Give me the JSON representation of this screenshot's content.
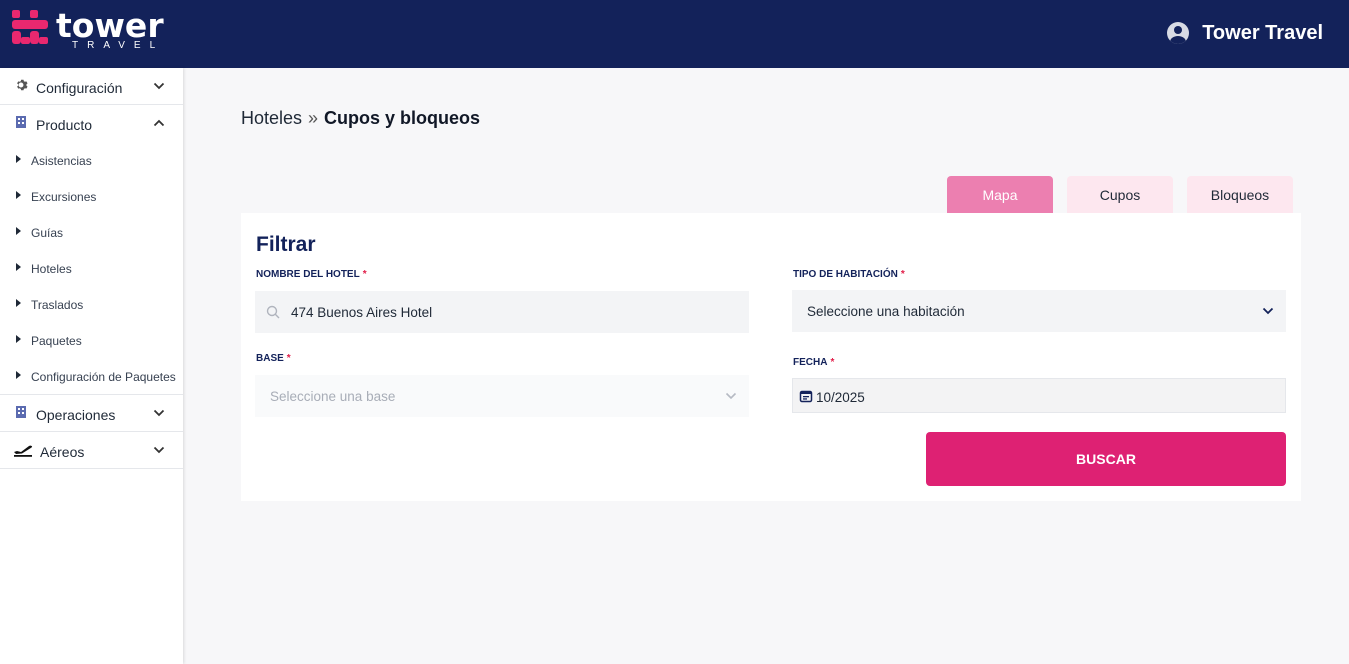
{
  "header": {
    "logo_word": "tower",
    "logo_sub": "TRAVEL",
    "user_name": "Tower Travel",
    "colors": {
      "bar": "#13225a",
      "brand_pink": "#e8286f"
    }
  },
  "sidebar": {
    "groups": [
      {
        "label": "Configuración",
        "icon": "gear-icon",
        "expanded": false
      },
      {
        "label": "Producto",
        "icon": "building-icon",
        "expanded": true,
        "items": [
          "Asistencias",
          "Excursiones",
          "Guías",
          "Hoteles",
          "Traslados",
          "Paquetes",
          "Configuración de Paquetes"
        ]
      },
      {
        "label": "Operaciones",
        "icon": "building-icon",
        "expanded": false
      },
      {
        "label": "Aéreos",
        "icon": "airplane-icon",
        "expanded": false
      }
    ]
  },
  "breadcrumb": {
    "parent": "Hoteles",
    "separator": "»",
    "current": "Cupos y bloqueos"
  },
  "tabs": [
    {
      "label": "Mapa",
      "active": true
    },
    {
      "label": "Cupos",
      "active": false
    },
    {
      "label": "Bloqueos",
      "active": false
    }
  ],
  "filter": {
    "title": "Filtrar",
    "hotel_label": "NOMBRE DEL HOTEL",
    "hotel_value": "474 Buenos Aires Hotel",
    "room_label": "TIPO DE HABITACIÓN",
    "room_value": "Seleccione una habitación",
    "base_label": "BASE",
    "base_placeholder": "Seleccione una base",
    "date_label": "FECHA",
    "date_value": "10/2025",
    "required_mark": "*",
    "search_button": "BUSCAR",
    "colors": {
      "button": "#de2173",
      "label": "#13225a"
    }
  }
}
